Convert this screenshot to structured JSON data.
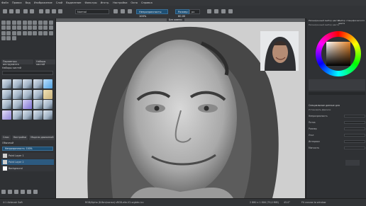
{
  "menu": [
    "Файл",
    "Правка",
    "Вид",
    "Изображение",
    "Слой",
    "Выделение",
    "Фильтры",
    "Инстр.",
    "Настройки",
    "Окно",
    "Справка"
  ],
  "toolbar": {
    "brush_name": "Normal",
    "opacity_label": "Непрозрачность: 100%",
    "size_label": "Размер: 60.00",
    "size_unit": "px"
  },
  "document_tab": "Без имени",
  "left_panel": {
    "tabs": [
      "Параметры инструмента",
      "Наборы кистей"
    ],
    "brush_preset_header": "Наборы кистей",
    "layer_tabs": [
      "Слои",
      "Настройки",
      "Модели движений"
    ],
    "blend_mode": "Обычный",
    "opacity_label": "Непрозрачность: 100%",
    "layers": [
      {
        "name": "Paint Layer 1",
        "selected": false
      },
      {
        "name": "Paint Layer 2",
        "selected": true
      },
      {
        "name": "Background",
        "selected": false
      }
    ]
  },
  "right_panel": {
    "header_left": "Расширенный выбор цвета",
    "header_right": "Выбор специфического цвета",
    "sub_header": "Расширенный выбор цвета",
    "color_accent": "#c8792a",
    "props_title": "Специальные данные для",
    "props_sub": "Установить Движок",
    "rows": [
      "Непрозрачность",
      "Поток",
      "Размер",
      "Угол",
      "Интервал",
      "Мягкость"
    ]
  },
  "status": {
    "left": "4:1 Airbrush Soft",
    "center": "RGB/Alpha (8-бит/канал) sRGB-elle-V2-srgbtrc.icc",
    "center_right": "2 880 x 1 800 (79,0 MiB)",
    "zoom": "45.0°",
    "right": "Fit canvas to window"
  }
}
